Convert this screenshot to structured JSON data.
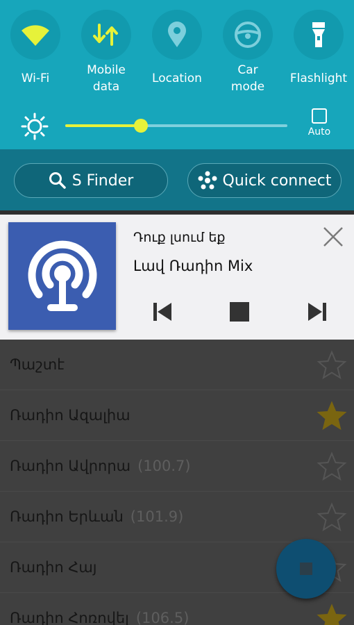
{
  "quick_settings": {
    "toggles": [
      {
        "label": "Wi-Fi",
        "icon": "wifi-icon",
        "active": true
      },
      {
        "label": "Mobile\ndata",
        "icon": "mobile-data-icon",
        "active": true
      },
      {
        "label": "Location",
        "icon": "location-icon",
        "active": false
      },
      {
        "label": "Car\nmode",
        "icon": "car-mode-icon",
        "active": false
      },
      {
        "label": "Flashlight",
        "icon": "flashlight-icon",
        "active": false
      }
    ],
    "brightness_level": 0.34,
    "auto_label": "Auto",
    "accent_color": "#17a6bb",
    "active_icon_color": "#e6f23a"
  },
  "actions": {
    "s_finder_label": "S Finder",
    "quick_connect_label": "Quick connect"
  },
  "notification": {
    "title": "Դուք լսում եք",
    "subtitle": "Լավ Ռադիո Mix",
    "artwork_icon": "podcast-icon"
  },
  "stations": [
    {
      "name": "Պաշտէ",
      "freq": "",
      "favorite": false
    },
    {
      "name": "Ռադիո Ազալիա",
      "freq": "",
      "favorite": true
    },
    {
      "name": "Ռադիո Ավրորա",
      "freq": "(100.7)",
      "favorite": false
    },
    {
      "name": "Ռադիո Երևան",
      "freq": "(101.9)",
      "favorite": false
    },
    {
      "name": "Ռադիո Հայ",
      "freq": "",
      "favorite": false
    },
    {
      "name": "Ռադիո Հոռովել",
      "freq": "(106.5)",
      "favorite": true
    }
  ]
}
